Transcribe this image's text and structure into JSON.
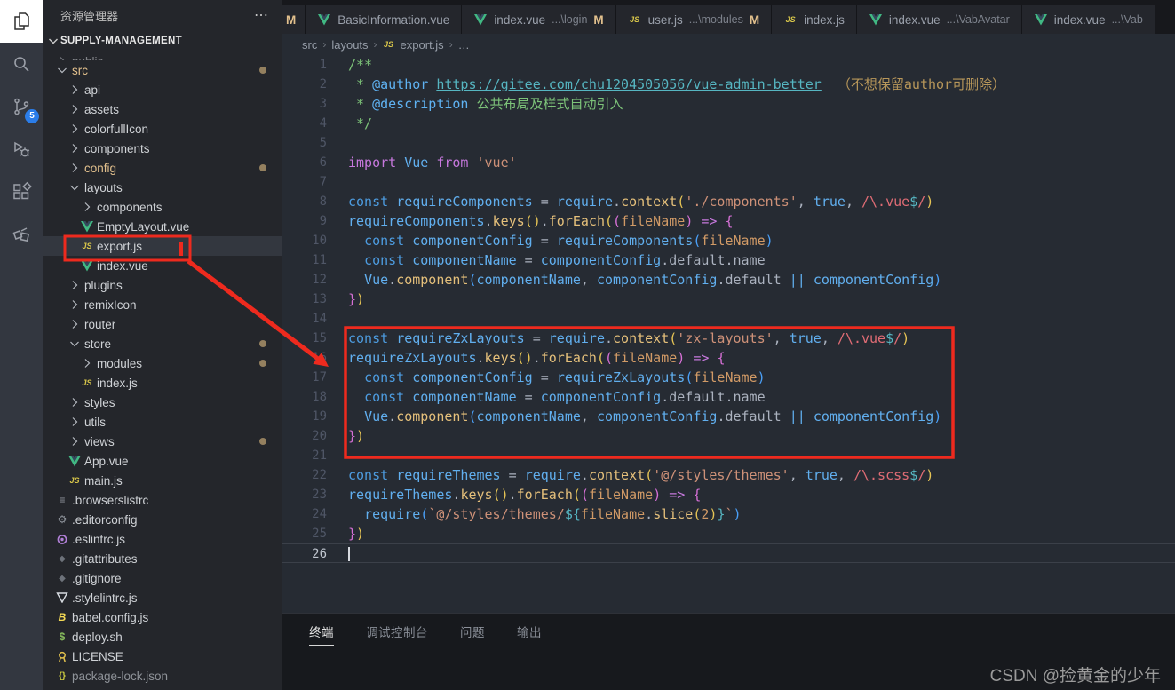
{
  "colors": {
    "annotation_red": "#ee2a1e",
    "modified": "#e2c08d",
    "scm_badge_blue": "#2b7de9",
    "vue_green": "#41b883",
    "js_yellow": "#d8c64a"
  },
  "activity_bar": {
    "items": [
      {
        "name": "explorer-icon",
        "active": true
      },
      {
        "name": "search-icon"
      },
      {
        "name": "source-control-icon",
        "badge": "5"
      },
      {
        "name": "run-debug-icon"
      },
      {
        "name": "extensions-icon"
      },
      {
        "name": "test-explorer-icon"
      }
    ]
  },
  "sidebar": {
    "title": "资源管理器",
    "more_label": "⋯",
    "section": "SUPPLY-MANAGEMENT",
    "tree": [
      {
        "label": "public",
        "type": "folder",
        "chev": "r",
        "level": 0,
        "clipped": true
      },
      {
        "label": "src",
        "type": "folder",
        "chev": "d",
        "level": 0,
        "mod": true,
        "badge": true
      },
      {
        "label": "api",
        "type": "folder",
        "chev": "r",
        "level": 1
      },
      {
        "label": "assets",
        "type": "folder",
        "chev": "r",
        "level": 1
      },
      {
        "label": "colorfullIcon",
        "type": "folder",
        "chev": "r",
        "level": 1
      },
      {
        "label": "components",
        "type": "folder",
        "chev": "r",
        "level": 1
      },
      {
        "label": "config",
        "type": "folder",
        "chev": "r",
        "level": 1,
        "mod": true,
        "badge": true
      },
      {
        "label": "layouts",
        "type": "folder",
        "chev": "d",
        "level": 1
      },
      {
        "label": "components",
        "type": "folder",
        "chev": "r",
        "level": 2
      },
      {
        "label": "EmptyLayout.vue",
        "icon": "vue",
        "level": 2
      },
      {
        "label": "export.js",
        "icon": "js",
        "level": 2,
        "selected": true
      },
      {
        "label": "index.vue",
        "icon": "vue",
        "level": 2
      },
      {
        "label": "plugins",
        "type": "folder",
        "chev": "r",
        "level": 1
      },
      {
        "label": "remixIcon",
        "type": "folder",
        "chev": "r",
        "level": 1
      },
      {
        "label": "router",
        "type": "folder",
        "chev": "r",
        "level": 1
      },
      {
        "label": "store",
        "type": "folder",
        "chev": "d",
        "level": 1,
        "badge": true
      },
      {
        "label": "modules",
        "type": "folder",
        "chev": "r",
        "level": 2,
        "badge": true
      },
      {
        "label": "index.js",
        "icon": "js",
        "level": 2
      },
      {
        "label": "styles",
        "type": "folder",
        "chev": "r",
        "level": 1
      },
      {
        "label": "utils",
        "type": "folder",
        "chev": "r",
        "level": 1
      },
      {
        "label": "views",
        "type": "folder",
        "chev": "r",
        "level": 1,
        "badge": true
      },
      {
        "label": "App.vue",
        "icon": "vue",
        "level": 1
      },
      {
        "label": "main.js",
        "icon": "js",
        "level": 1
      },
      {
        "label": ".browserslistrc",
        "icon": "list",
        "level": 0
      },
      {
        "label": ".editorconfig",
        "icon": "gear",
        "level": 0
      },
      {
        "label": ".eslintrc.js",
        "icon": "eslint",
        "level": 0
      },
      {
        "label": ".gitattributes",
        "icon": "git",
        "level": 0
      },
      {
        "label": ".gitignore",
        "icon": "git",
        "level": 0
      },
      {
        "label": ".stylelintrc.js",
        "icon": "stylelint",
        "level": 0
      },
      {
        "label": "babel.config.js",
        "icon": "babel",
        "level": 0
      },
      {
        "label": "deploy.sh",
        "icon": "shell",
        "level": 0
      },
      {
        "label": "LICENSE",
        "icon": "license",
        "level": 0
      },
      {
        "label": "package-lock.json",
        "icon": "json",
        "level": 0,
        "dim": true
      }
    ]
  },
  "tabs": [
    {
      "label": "M",
      "partial": true,
      "modcolor": true
    },
    {
      "icon": "vue",
      "label": "BasicInformation.vue"
    },
    {
      "icon": "vue",
      "label": "index.vue",
      "detail": "...\\login",
      "mod": "M"
    },
    {
      "icon": "js",
      "label": "user.js",
      "detail": "...\\modules",
      "mod": "M"
    },
    {
      "icon": "js",
      "label": "index.js"
    },
    {
      "icon": "vue",
      "label": "index.vue",
      "detail": "...\\VabAvatar"
    },
    {
      "icon": "vue",
      "label": "index.vue",
      "detail": "...\\Vab"
    }
  ],
  "breadcrumb": {
    "items": [
      "src",
      "layouts",
      "export.js",
      "…"
    ],
    "file_icon_index": 2
  },
  "editor": {
    "active_line": 26,
    "lines": [
      {
        "n": 1,
        "seg": [
          [
            "/**",
            "c"
          ]
        ]
      },
      {
        "n": 2,
        "seg": [
          [
            " * ",
            "c"
          ],
          [
            "@author",
            "at"
          ],
          [
            " ",
            "c"
          ],
          [
            "https://gitee.com/chu1204505056/vue-admin-better",
            "lk"
          ],
          [
            "  （不想保留author可删除）",
            "tn"
          ]
        ]
      },
      {
        "n": 3,
        "seg": [
          [
            " * ",
            "c"
          ],
          [
            "@description",
            "at"
          ],
          [
            " ",
            "c"
          ],
          [
            "公共布局及样式自动引入",
            "c"
          ]
        ]
      },
      {
        "n": 4,
        "seg": [
          [
            " */",
            "c"
          ]
        ]
      },
      {
        "n": 5,
        "seg": []
      },
      {
        "n": 6,
        "seg": [
          [
            "import",
            "kp"
          ],
          [
            " ",
            "p"
          ],
          [
            "Vue",
            "v"
          ],
          [
            " ",
            "p"
          ],
          [
            "from",
            "kp"
          ],
          [
            " ",
            "p"
          ],
          [
            "'vue'",
            "s"
          ]
        ]
      },
      {
        "n": 7,
        "seg": []
      },
      {
        "n": 8,
        "seg": [
          [
            "const",
            "kc"
          ],
          [
            " ",
            "p"
          ],
          [
            "requireComponents",
            "v"
          ],
          [
            " = ",
            "p"
          ],
          [
            "require",
            "v"
          ],
          [
            ".",
            "p"
          ],
          [
            "context",
            "fn"
          ],
          [
            "(",
            "y"
          ],
          [
            "'./components'",
            "s"
          ],
          [
            ", ",
            "p"
          ],
          [
            "true",
            "b"
          ],
          [
            ", ",
            "p"
          ],
          [
            "/\\.vue",
            "re"
          ],
          [
            "$",
            "t2"
          ],
          [
            "/",
            "re"
          ],
          [
            ")",
            "y"
          ]
        ]
      },
      {
        "n": 9,
        "seg": [
          [
            "requireComponents",
            "v"
          ],
          [
            ".",
            "p"
          ],
          [
            "keys",
            "fn"
          ],
          [
            "()",
            "y"
          ],
          [
            ".",
            "p"
          ],
          [
            "forEach",
            "fn"
          ],
          [
            "(",
            "y"
          ],
          [
            "(",
            "m"
          ],
          [
            "fileName",
            "o"
          ],
          [
            ")",
            "m"
          ],
          [
            " ",
            "p"
          ],
          [
            "=>",
            "kp"
          ],
          [
            " ",
            "p"
          ],
          [
            "{",
            "m"
          ]
        ]
      },
      {
        "n": 10,
        "seg": [
          [
            "  ",
            "p"
          ],
          [
            "const",
            "kc"
          ],
          [
            " ",
            "p"
          ],
          [
            "componentConfig",
            "v"
          ],
          [
            " = ",
            "p"
          ],
          [
            "requireComponents",
            "v"
          ],
          [
            "(",
            "bl"
          ],
          [
            "fileName",
            "o"
          ],
          [
            ")",
            "bl"
          ]
        ]
      },
      {
        "n": 11,
        "seg": [
          [
            "  ",
            "p"
          ],
          [
            "const",
            "kc"
          ],
          [
            " ",
            "p"
          ],
          [
            "componentName",
            "v"
          ],
          [
            " = ",
            "p"
          ],
          [
            "componentConfig",
            "v"
          ],
          [
            ".",
            "p"
          ],
          [
            "default",
            "pr"
          ],
          [
            ".",
            "p"
          ],
          [
            "name",
            "pr"
          ]
        ]
      },
      {
        "n": 12,
        "seg": [
          [
            "  ",
            "p"
          ],
          [
            "Vue",
            "v"
          ],
          [
            ".",
            "p"
          ],
          [
            "component",
            "fn"
          ],
          [
            "(",
            "bl"
          ],
          [
            "componentName",
            "v"
          ],
          [
            ", ",
            "p"
          ],
          [
            "componentConfig",
            "v"
          ],
          [
            ".",
            "p"
          ],
          [
            "default",
            "pr"
          ],
          [
            " ",
            "p"
          ],
          [
            "||",
            "b"
          ],
          [
            " ",
            "p"
          ],
          [
            "componentConfig",
            "v"
          ],
          [
            ")",
            "bl"
          ]
        ]
      },
      {
        "n": 13,
        "seg": [
          [
            "}",
            "m"
          ],
          [
            ")",
            "y"
          ]
        ]
      },
      {
        "n": 14,
        "seg": []
      },
      {
        "n": 15,
        "seg": [
          [
            "const",
            "kc"
          ],
          [
            " ",
            "p"
          ],
          [
            "requireZxLayouts",
            "v"
          ],
          [
            " = ",
            "p"
          ],
          [
            "require",
            "v"
          ],
          [
            ".",
            "p"
          ],
          [
            "context",
            "fn"
          ],
          [
            "(",
            "y"
          ],
          [
            "'zx-layouts'",
            "s"
          ],
          [
            ", ",
            "p"
          ],
          [
            "true",
            "b"
          ],
          [
            ", ",
            "p"
          ],
          [
            "/\\.vue",
            "re"
          ],
          [
            "$",
            "t2"
          ],
          [
            "/",
            "re"
          ],
          [
            ")",
            "y"
          ]
        ]
      },
      {
        "n": 16,
        "seg": [
          [
            "requireZxLayouts",
            "v"
          ],
          [
            ".",
            "p"
          ],
          [
            "keys",
            "fn"
          ],
          [
            "()",
            "y"
          ],
          [
            ".",
            "p"
          ],
          [
            "forEach",
            "fn"
          ],
          [
            "(",
            "y"
          ],
          [
            "(",
            "m"
          ],
          [
            "fileName",
            "o"
          ],
          [
            ")",
            "m"
          ],
          [
            " ",
            "p"
          ],
          [
            "=>",
            "kp"
          ],
          [
            " ",
            "p"
          ],
          [
            "{",
            "m"
          ]
        ]
      },
      {
        "n": 17,
        "seg": [
          [
            "  ",
            "p"
          ],
          [
            "const",
            "kc"
          ],
          [
            " ",
            "p"
          ],
          [
            "componentConfig",
            "v"
          ],
          [
            " = ",
            "p"
          ],
          [
            "requireZxLayouts",
            "v"
          ],
          [
            "(",
            "bl"
          ],
          [
            "fileName",
            "o"
          ],
          [
            ")",
            "bl"
          ]
        ]
      },
      {
        "n": 18,
        "seg": [
          [
            "  ",
            "p"
          ],
          [
            "const",
            "kc"
          ],
          [
            " ",
            "p"
          ],
          [
            "componentName",
            "v"
          ],
          [
            " = ",
            "p"
          ],
          [
            "componentConfig",
            "v"
          ],
          [
            ".",
            "p"
          ],
          [
            "default",
            "pr"
          ],
          [
            ".",
            "p"
          ],
          [
            "name",
            "pr"
          ]
        ]
      },
      {
        "n": 19,
        "seg": [
          [
            "  ",
            "p"
          ],
          [
            "Vue",
            "v"
          ],
          [
            ".",
            "p"
          ],
          [
            "component",
            "fn"
          ],
          [
            "(",
            "bl"
          ],
          [
            "componentName",
            "v"
          ],
          [
            ", ",
            "p"
          ],
          [
            "componentConfig",
            "v"
          ],
          [
            ".",
            "p"
          ],
          [
            "default",
            "pr"
          ],
          [
            " ",
            "p"
          ],
          [
            "||",
            "b"
          ],
          [
            " ",
            "p"
          ],
          [
            "componentConfig",
            "v"
          ],
          [
            ")",
            "bl"
          ]
        ]
      },
      {
        "n": 20,
        "seg": [
          [
            "}",
            "m"
          ],
          [
            ")",
            "y"
          ]
        ]
      },
      {
        "n": 21,
        "seg": []
      },
      {
        "n": 22,
        "seg": [
          [
            "const",
            "kc"
          ],
          [
            " ",
            "p"
          ],
          [
            "requireThemes",
            "v"
          ],
          [
            " = ",
            "p"
          ],
          [
            "require",
            "v"
          ],
          [
            ".",
            "p"
          ],
          [
            "context",
            "fn"
          ],
          [
            "(",
            "y"
          ],
          [
            "'@/styles/themes'",
            "s"
          ],
          [
            ", ",
            "p"
          ],
          [
            "true",
            "b"
          ],
          [
            ", ",
            "p"
          ],
          [
            "/\\.scss",
            "re"
          ],
          [
            "$",
            "t2"
          ],
          [
            "/",
            "re"
          ],
          [
            ")",
            "y"
          ]
        ]
      },
      {
        "n": 23,
        "seg": [
          [
            "requireThemes",
            "v"
          ],
          [
            ".",
            "p"
          ],
          [
            "keys",
            "fn"
          ],
          [
            "()",
            "y"
          ],
          [
            ".",
            "p"
          ],
          [
            "forEach",
            "fn"
          ],
          [
            "(",
            "y"
          ],
          [
            "(",
            "m"
          ],
          [
            "fileName",
            "o"
          ],
          [
            ")",
            "m"
          ],
          [
            " ",
            "p"
          ],
          [
            "=>",
            "kp"
          ],
          [
            " ",
            "p"
          ],
          [
            "{",
            "m"
          ]
        ]
      },
      {
        "n": 24,
        "seg": [
          [
            "  ",
            "p"
          ],
          [
            "require",
            "v"
          ],
          [
            "(",
            "bl"
          ],
          [
            "`@/styles/themes/",
            "s"
          ],
          [
            "${",
            "t2"
          ],
          [
            "fileName",
            "o"
          ],
          [
            ".",
            "p"
          ],
          [
            "slice",
            "fn"
          ],
          [
            "(",
            "y"
          ],
          [
            "2",
            "o"
          ],
          [
            ")",
            "y"
          ],
          [
            "}",
            "t2"
          ],
          [
            "`",
            "s"
          ],
          [
            ")",
            "bl"
          ]
        ]
      },
      {
        "n": 25,
        "seg": [
          [
            "}",
            "m"
          ],
          [
            ")",
            "y"
          ]
        ]
      },
      {
        "n": 26,
        "seg": []
      }
    ]
  },
  "panel": {
    "tabs": [
      {
        "label": "终端",
        "active": true
      },
      {
        "label": "调试控制台"
      },
      {
        "label": "问题"
      },
      {
        "label": "输出"
      }
    ]
  },
  "watermark": "CSDN @捡黄金的少年"
}
